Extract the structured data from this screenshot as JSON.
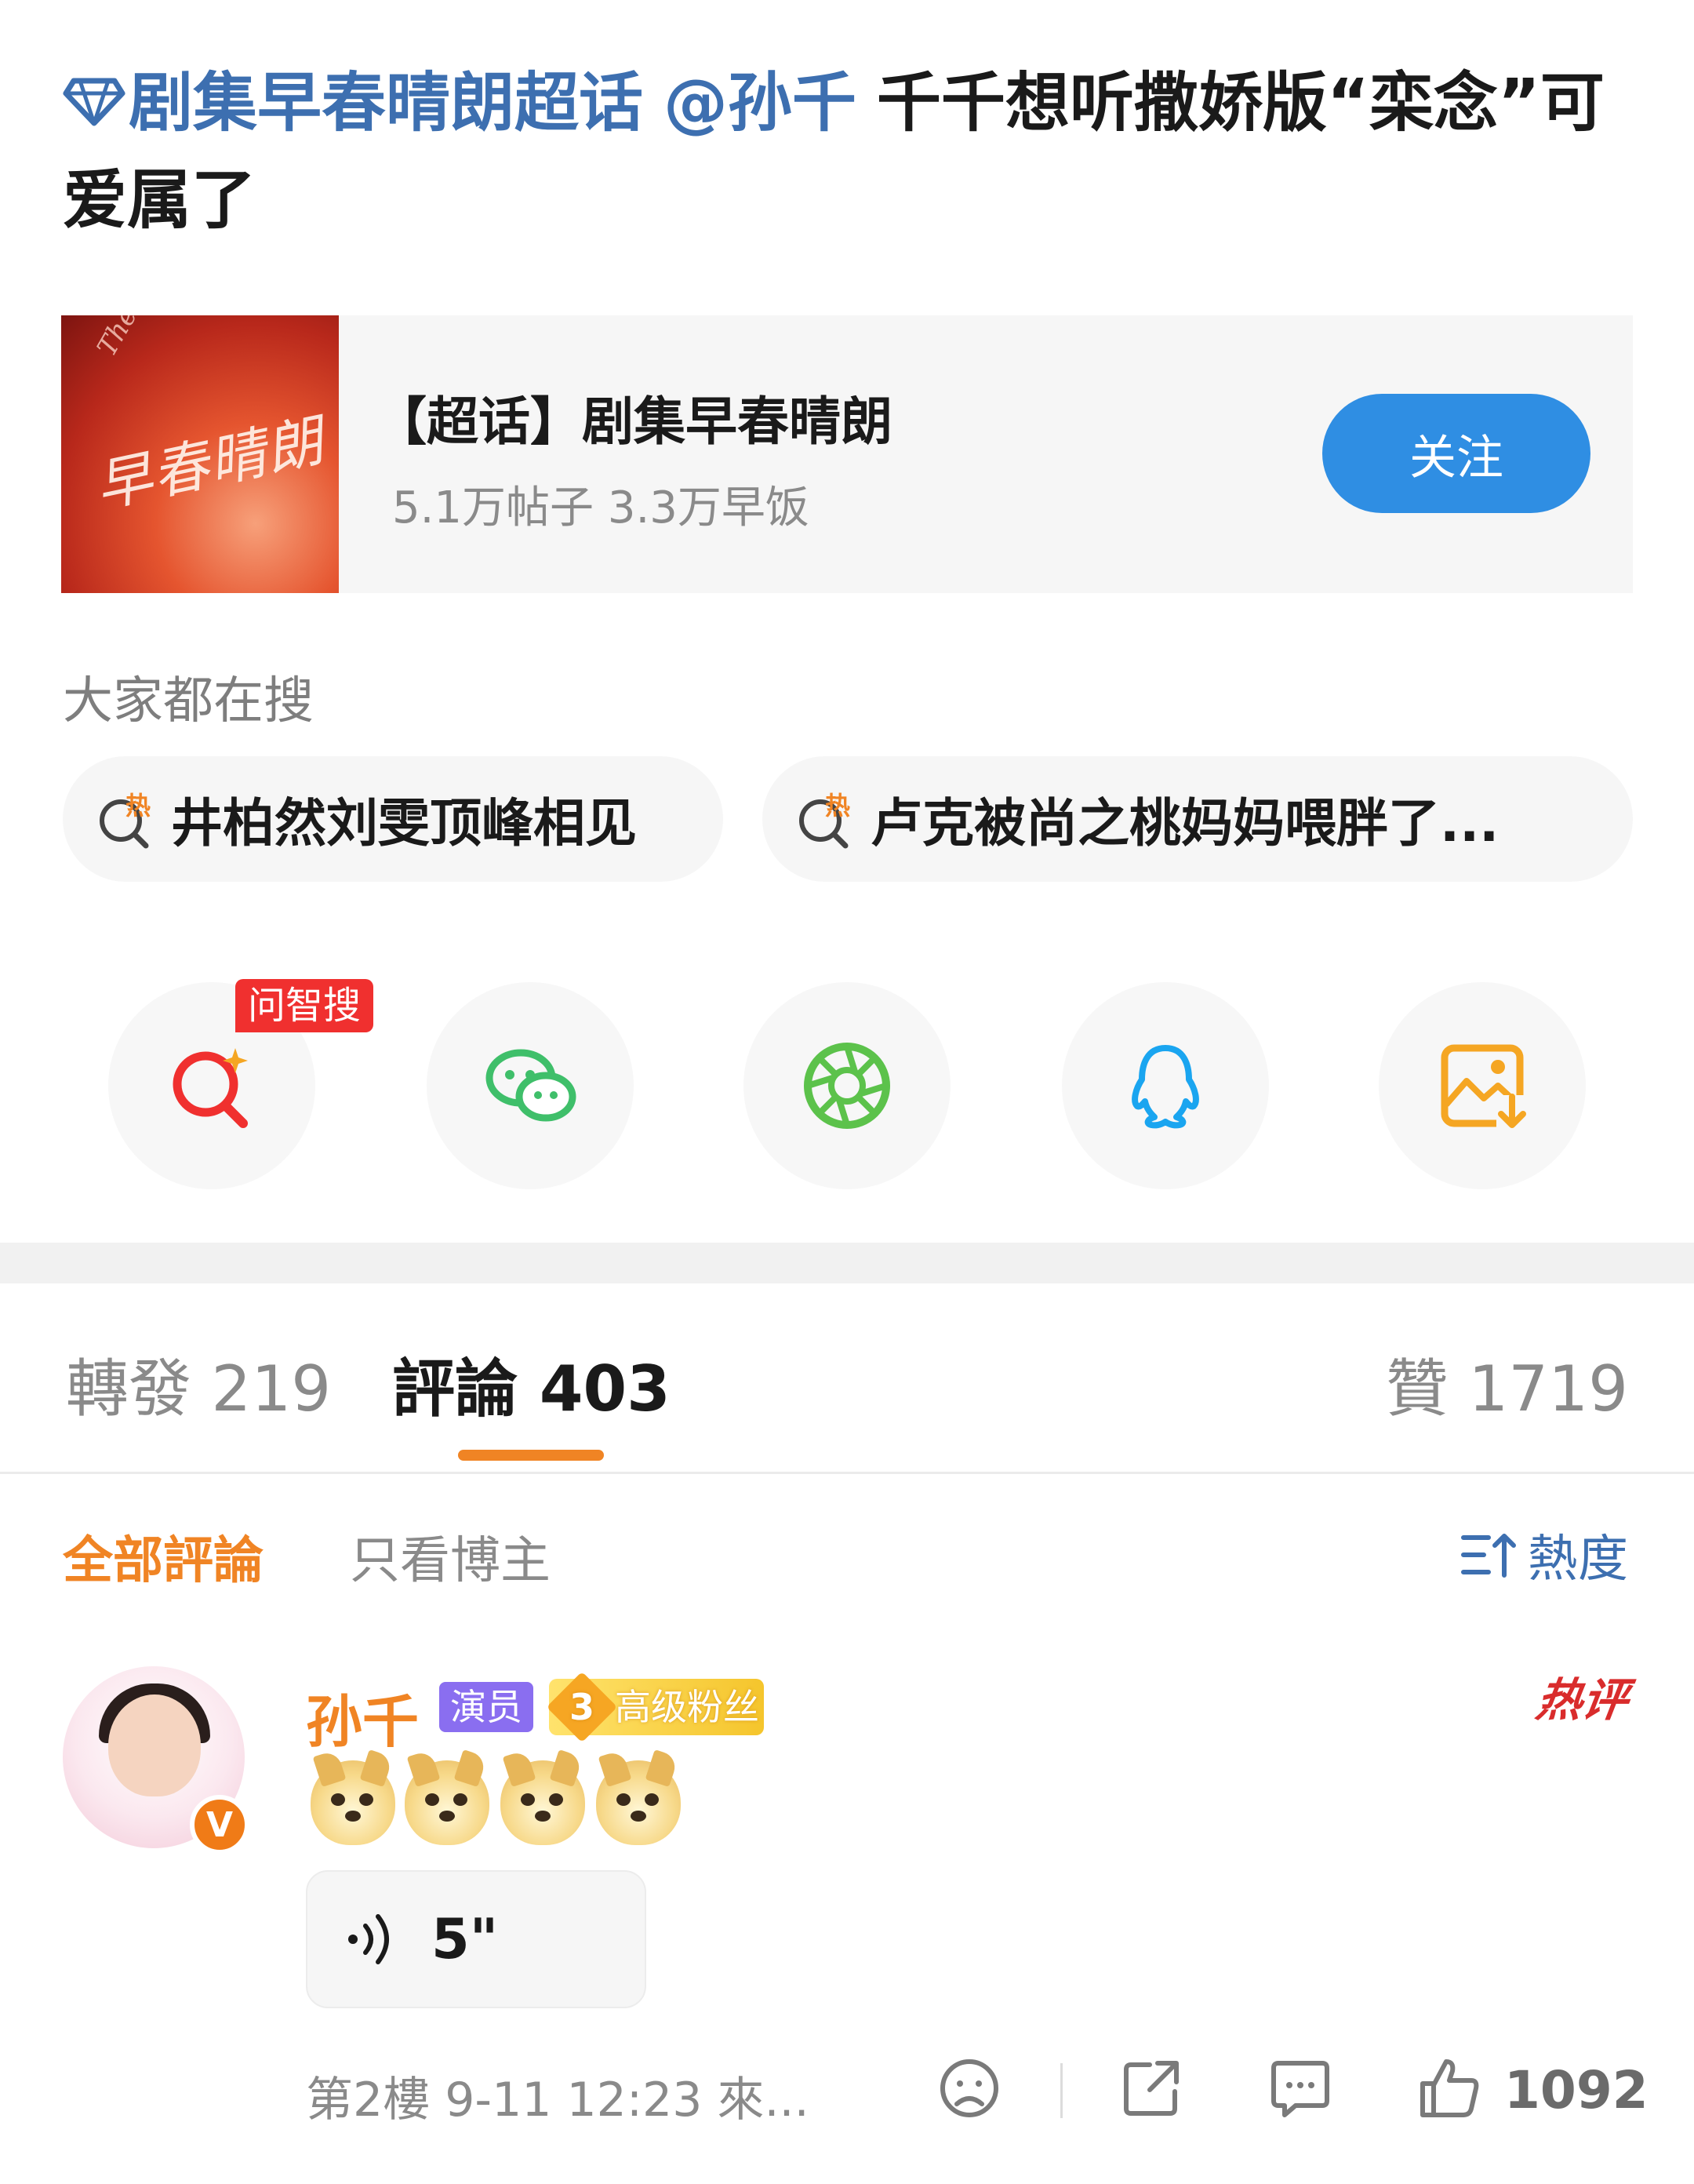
{
  "post": {
    "topic": "剧集早春晴朗超话",
    "mention": "@孙千",
    "text": "千千想听撒娇版“栾念”可爱属了"
  },
  "super_topic_card": {
    "cover_text": "早春晴朗",
    "cover_en": "The Early Spring",
    "title": "【超话】剧集早春晴朗",
    "stats": "5.1万帖子 3.3万早饭",
    "follow_label": "关注"
  },
  "trending": {
    "heading": "大家都在搜",
    "items": [
      {
        "label": "井柏然刘雯顶峰相见",
        "icon": "hot-search-icon"
      },
      {
        "label": "卢克被尚之桃妈妈喂胖了...",
        "icon": "hot-search-icon"
      }
    ]
  },
  "share": {
    "ask_badge": "问智搜",
    "items": [
      {
        "name": "ai-search-icon",
        "color": "#f0302f"
      },
      {
        "name": "wechat-icon",
        "color": "#3fbf6a"
      },
      {
        "name": "moments-icon",
        "color": "#5cc24b"
      },
      {
        "name": "qq-icon",
        "color": "#1aa5f0"
      },
      {
        "name": "save-image-icon",
        "color": "#f5a623"
      }
    ]
  },
  "tabs": {
    "repost": "轉發 219",
    "comment": "評論 403",
    "like": "贊 1719"
  },
  "filters": {
    "all": "全部評論",
    "owner_only": "只看博主",
    "sort": "熱度"
  },
  "comment": {
    "username": "孙千",
    "role_tag": "演员",
    "fan_level": "3",
    "fan_tag": "高级粉丝",
    "hot_badge": "热评",
    "verified": "V",
    "emoji_count": 4,
    "emoji": "doge-emoji",
    "voice_duration": "5\"",
    "meta": "第2樓 9-11 12:23 來...",
    "like_count": "1092"
  },
  "colors": {
    "link_blue": "#3d6fb0",
    "accent_orange": "#f08424",
    "follow_blue": "#2f8ee3"
  }
}
